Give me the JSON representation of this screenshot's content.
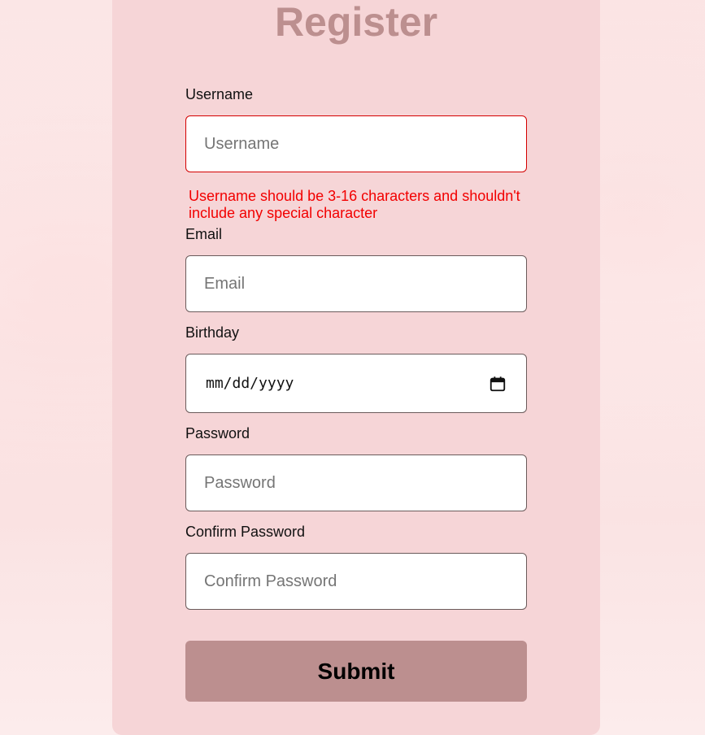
{
  "form": {
    "title": "Register",
    "username": {
      "label": "Username",
      "placeholder": "Username",
      "value": "",
      "error": "Username should be 3-16 characters and shouldn't include any special character"
    },
    "email": {
      "label": "Email",
      "placeholder": "Email",
      "value": ""
    },
    "birthday": {
      "label": "Birthday",
      "format_text": "mm/dd/yyyy",
      "icon": "calendar-icon"
    },
    "password": {
      "label": "Password",
      "placeholder": "Password",
      "value": ""
    },
    "confirm_password": {
      "label": "Confirm Password",
      "placeholder": "Confirm Password",
      "value": ""
    },
    "submit_label": "Submit"
  },
  "colors": {
    "card_background": "#f6d5d7",
    "accent": "#bc8f8f",
    "error": "#f20000",
    "invalid_border": "#d40000"
  }
}
